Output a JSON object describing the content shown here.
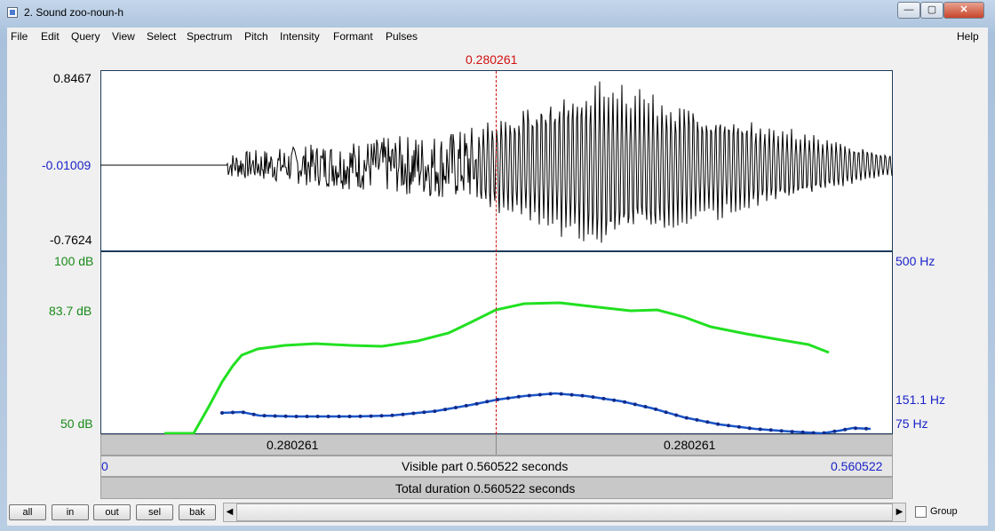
{
  "window": {
    "title": "2. Sound zoo-noun-h",
    "controls": [
      "—",
      "▢",
      "✕"
    ]
  },
  "menu": {
    "items": [
      "File",
      "Edit",
      "Query",
      "View",
      "Select",
      "Spectrum",
      "Pitch",
      "Intensity",
      "Formant",
      "Pulses"
    ],
    "help": "Help"
  },
  "cursor": {
    "time": "0.280261"
  },
  "waveform": {
    "max": "0.8467",
    "zero": "-0.01009",
    "min": "-0.7624"
  },
  "analysis": {
    "intensity_top": "100 dB",
    "intensity_mid": "83.7 dB",
    "intensity_bottom": "50 dB",
    "pitch_top": "500 Hz",
    "pitch_mid": "151.1 Hz",
    "pitch_bottom": "75 Hz"
  },
  "timebar": {
    "left_duration": "0.280261",
    "right_duration": "0.280261"
  },
  "visible": {
    "start": "0",
    "text": "Visible part 0.560522 seconds",
    "end": "0.560522"
  },
  "total": {
    "text": "Total duration 0.560522 seconds"
  },
  "buttons": {
    "all": "all",
    "in": "in",
    "out": "out",
    "sel": "sel",
    "bak": "bak"
  },
  "group": {
    "label": "Group",
    "checked": false
  },
  "colors": {
    "intensity": "#22e022",
    "pitch": "#1a55c8",
    "cursor": "#d01010",
    "axis_blue": "#1a22c8",
    "axis_green": "#1a8a1a"
  }
}
